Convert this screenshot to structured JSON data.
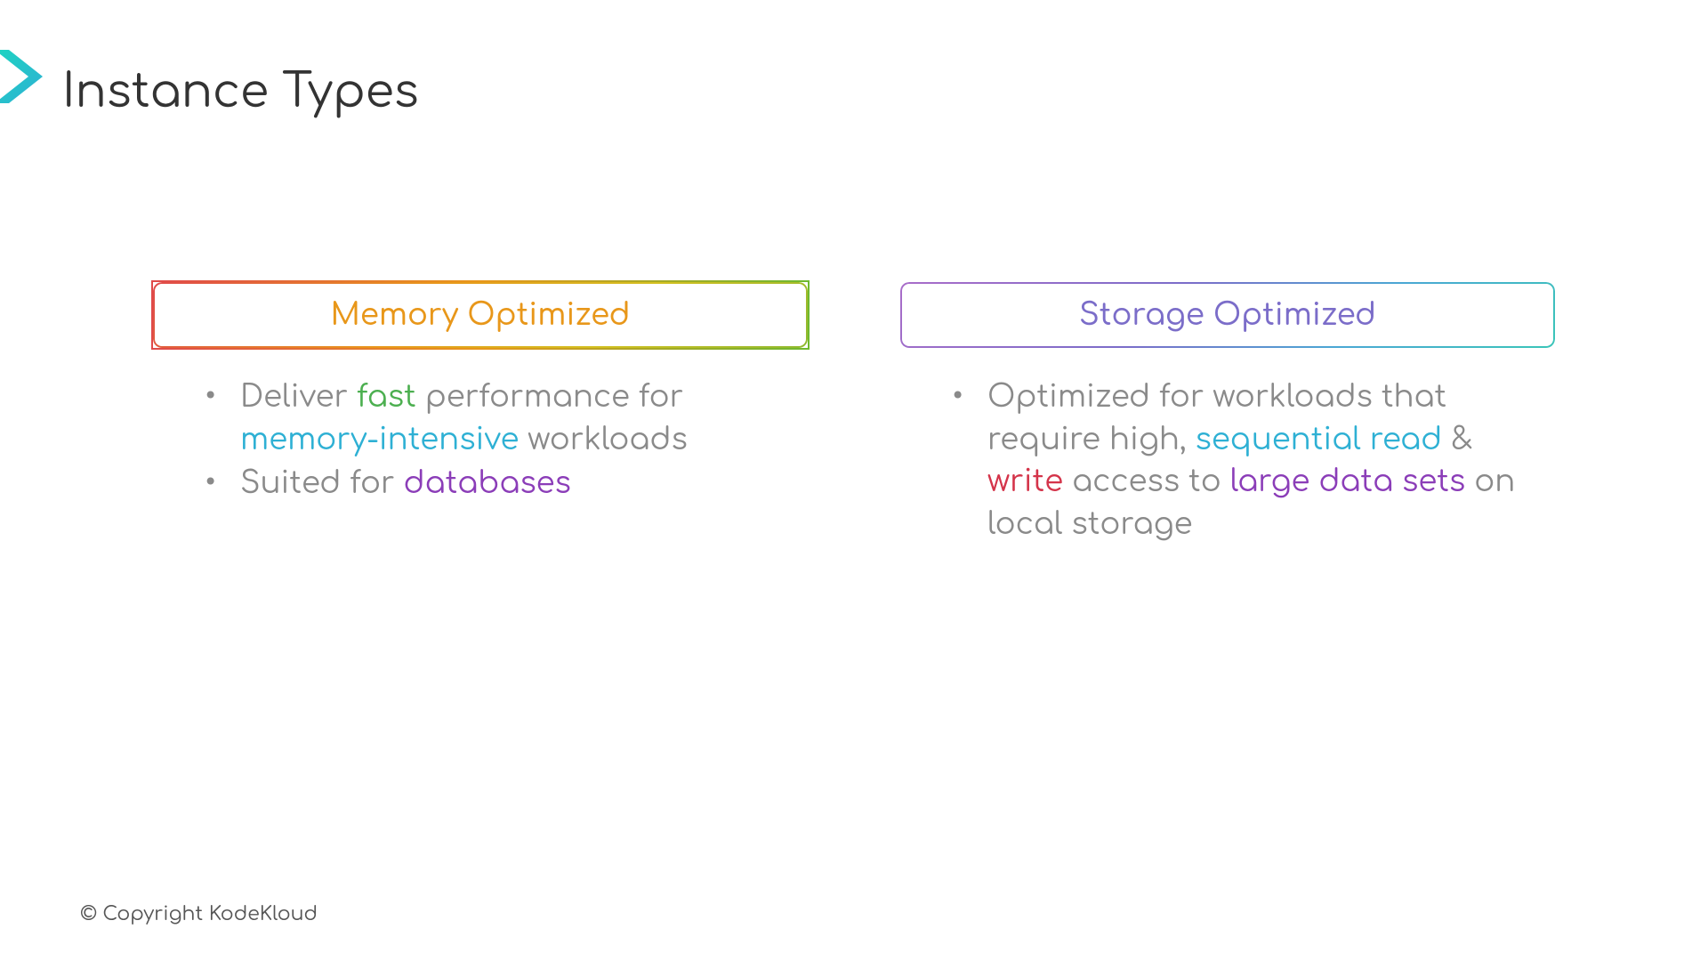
{
  "title": "Instance Types",
  "copyright": "© Copyright KodeKloud",
  "columns": {
    "memory": {
      "header": "Memory Optimized",
      "bullets": [
        {
          "segments": [
            {
              "text": "Deliver ",
              "cls": ""
            },
            {
              "text": "fast",
              "cls": "hl-green"
            },
            {
              "text": " performance for ",
              "cls": ""
            },
            {
              "text": "memory-intensive",
              "cls": "hl-cyan"
            },
            {
              "text": " workloads",
              "cls": ""
            }
          ]
        },
        {
          "segments": [
            {
              "text": "Suited for ",
              "cls": ""
            },
            {
              "text": "databases",
              "cls": "hl-purple"
            }
          ]
        }
      ]
    },
    "storage": {
      "header": "Storage Optimized",
      "bullets": [
        {
          "segments": [
            {
              "text": "Optimized for workloads that require high, ",
              "cls": ""
            },
            {
              "text": "sequential read",
              "cls": "hl-cyan"
            },
            {
              "text": " & ",
              "cls": ""
            },
            {
              "text": "write",
              "cls": "hl-red"
            },
            {
              "text": " access to ",
              "cls": ""
            },
            {
              "text": "large data sets",
              "cls": "hl-purple"
            },
            {
              "text": " on local storage",
              "cls": ""
            }
          ]
        }
      ]
    }
  }
}
